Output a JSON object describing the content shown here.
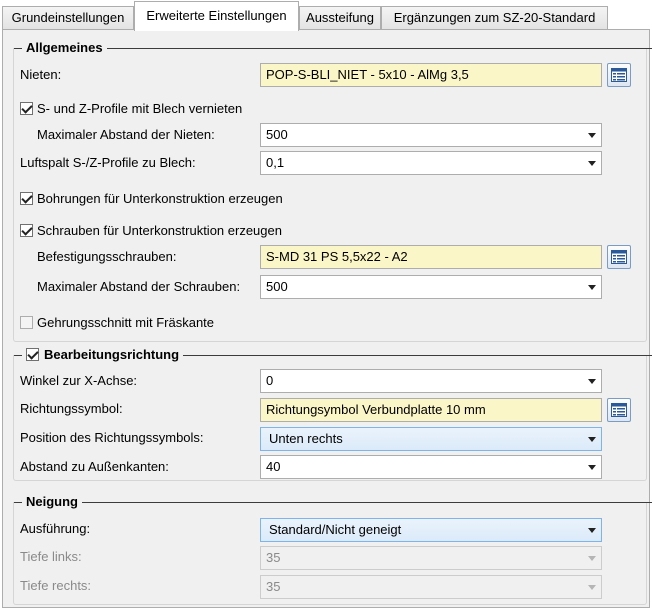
{
  "tabs": [
    {
      "label": "Grundeinstellungen"
    },
    {
      "label": "Erweiterte Einstellungen"
    },
    {
      "label": "Aussteifung"
    },
    {
      "label": "Ergänzungen zum SZ-20-Standard"
    }
  ],
  "allgemeines": {
    "title": "Allgemeines",
    "nieten_label": "Nieten:",
    "nieten_value": "POP-S-BLI_NIET -  5x10 - AlMg 3,5",
    "vernieten_label": "S- und Z-Profile mit Blech vernieten",
    "vernieten_checked": true,
    "max_abstand_nieten_label": "Maximaler Abstand der Nieten:",
    "max_abstand_nieten_value": "500",
    "luftspalt_label": "Luftspalt S-/Z-Profile zu Blech:",
    "luftspalt_value": "0,1",
    "bohrungen_label": "Bohrungen für Unterkonstruktion erzeugen",
    "bohrungen_checked": true,
    "schrauben_label": "Schrauben für Unterkonstruktion erzeugen",
    "schrauben_checked": true,
    "befestigung_label": "Befestigungsschrauben:",
    "befestigung_value": "S-MD 31 PS 5,5x22 - A2",
    "max_abstand_schrauben_label": "Maximaler Abstand der Schrauben:",
    "max_abstand_schrauben_value": "500",
    "gehrung_label": "Gehrungsschnitt mit Fräskante",
    "gehrung_checked": false
  },
  "bearbeitung": {
    "title": "Bearbeitungsrichtung",
    "enabled": true,
    "winkel_label": "Winkel zur X-Achse:",
    "winkel_value": "0",
    "symbol_label": "Richtungssymbol:",
    "symbol_value": "Richtungsymbol Verbundplatte 10 mm",
    "position_label": "Position des Richtungssymbols:",
    "position_value": "Unten rechts",
    "abstand_label": "Abstand zu Außenkanten:",
    "abstand_value": "40"
  },
  "neigung": {
    "title": "Neigung",
    "ausfuehrung_label": "Ausführung:",
    "ausfuehrung_value": "Standard/Nicht geneigt",
    "tiefe_links_label": "Tiefe links:",
    "tiefe_links_value": "35",
    "tiefe_rechts_label": "Tiefe rechts:",
    "tiefe_rechts_value": "35"
  },
  "icons": {
    "catalog": "catalog-browse-icon",
    "dropdown": "chevron-down-icon",
    "check": "check-icon"
  },
  "colors": {
    "field_bg": "#fbf6c7",
    "panel_bg": "#f0f0f0",
    "highlight_combo": "#dbeaf9"
  }
}
